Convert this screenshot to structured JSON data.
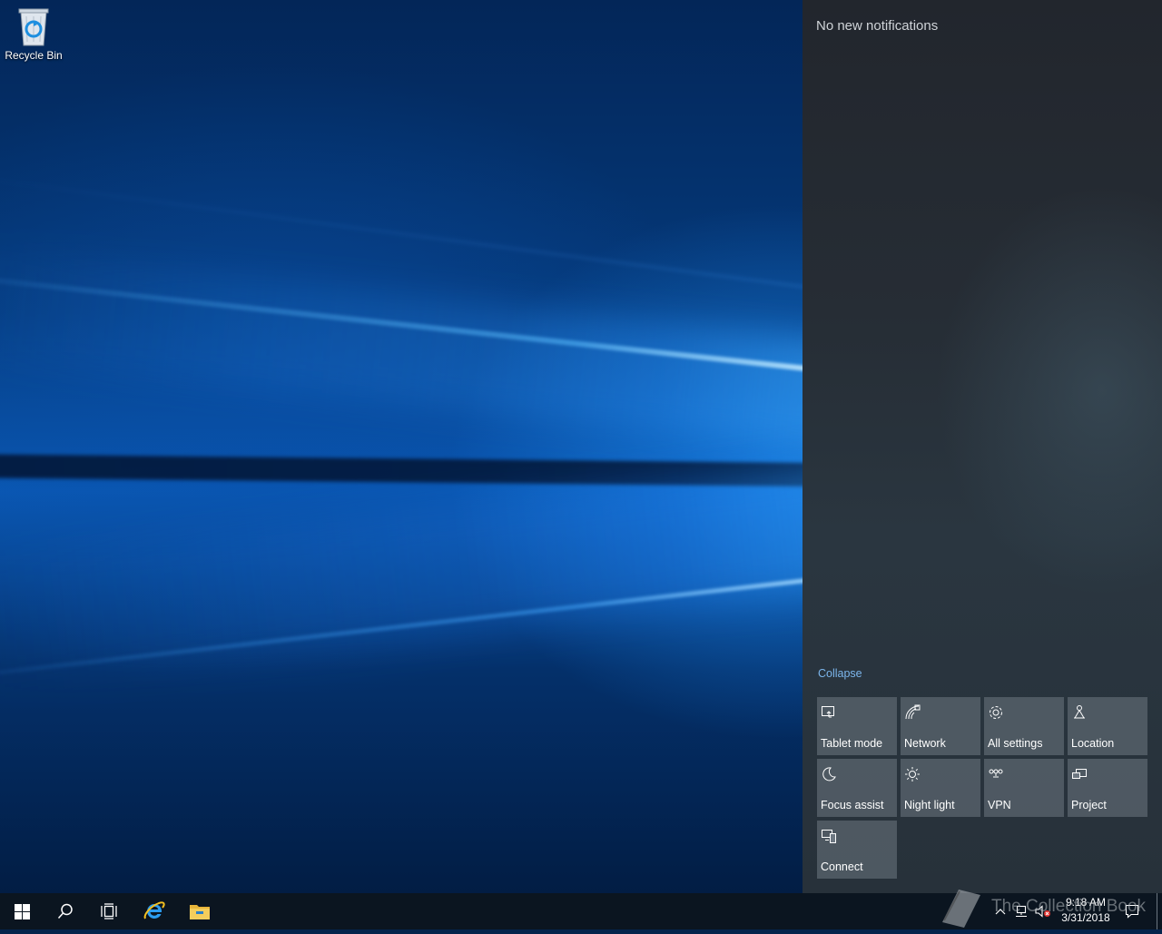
{
  "desktop": {
    "icons": [
      {
        "label": "Recycle Bin",
        "icon": "recycle-bin-icon"
      }
    ]
  },
  "action_center": {
    "heading": "No new notifications",
    "collapse_label": "Collapse",
    "quick_actions": [
      {
        "label": "Tablet mode",
        "icon": "tablet-mode-icon"
      },
      {
        "label": "Network",
        "icon": "network-icon"
      },
      {
        "label": "All settings",
        "icon": "gear-icon"
      },
      {
        "label": "Location",
        "icon": "location-icon"
      },
      {
        "label": "Focus assist",
        "icon": "moon-icon"
      },
      {
        "label": "Night light",
        "icon": "sun-icon"
      },
      {
        "label": "VPN",
        "icon": "vpn-icon"
      },
      {
        "label": "Project",
        "icon": "project-icon"
      },
      {
        "label": "Connect",
        "icon": "connect-icon"
      }
    ]
  },
  "taskbar": {
    "items": [
      {
        "icon": "windows-start-icon"
      },
      {
        "icon": "search-icon"
      },
      {
        "icon": "task-view-icon"
      },
      {
        "icon": "internet-explorer-icon"
      },
      {
        "icon": "file-explorer-icon"
      }
    ],
    "tray": {
      "time": "9:18 AM",
      "date": "3/31/2018",
      "icons": [
        "chevron-up-icon",
        "network-tray-icon",
        "volume-muted-icon",
        "action-center-icon"
      ]
    },
    "watermark": "The Collection Book"
  },
  "colors": {
    "accent_link": "#7cb6ec",
    "taskbar": "#0b1520",
    "tile": "#6e7882"
  }
}
